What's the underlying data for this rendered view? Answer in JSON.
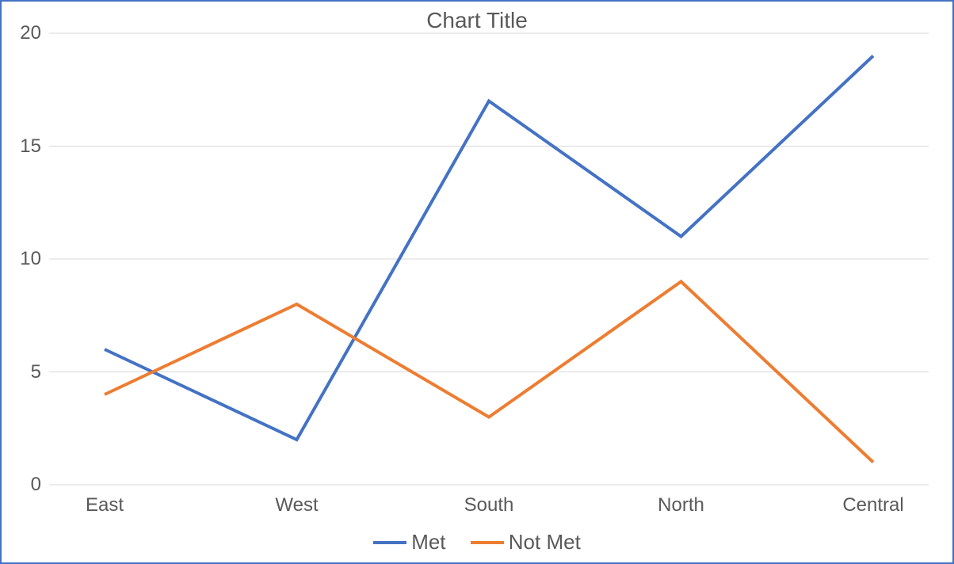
{
  "chart_data": {
    "type": "line",
    "title": "Chart Title",
    "xlabel": "",
    "ylabel": "",
    "ylim": [
      0,
      20
    ],
    "yticks": [
      0,
      5,
      10,
      15,
      20
    ],
    "categories": [
      "East",
      "West",
      "South",
      "North",
      "Central"
    ],
    "series": [
      {
        "name": "Met",
        "color": "#4472C4",
        "values": [
          6,
          2,
          17,
          11,
          19
        ]
      },
      {
        "name": "Not Met",
        "color": "#ED7D31",
        "values": [
          4,
          8,
          3,
          9,
          1
        ]
      }
    ]
  }
}
